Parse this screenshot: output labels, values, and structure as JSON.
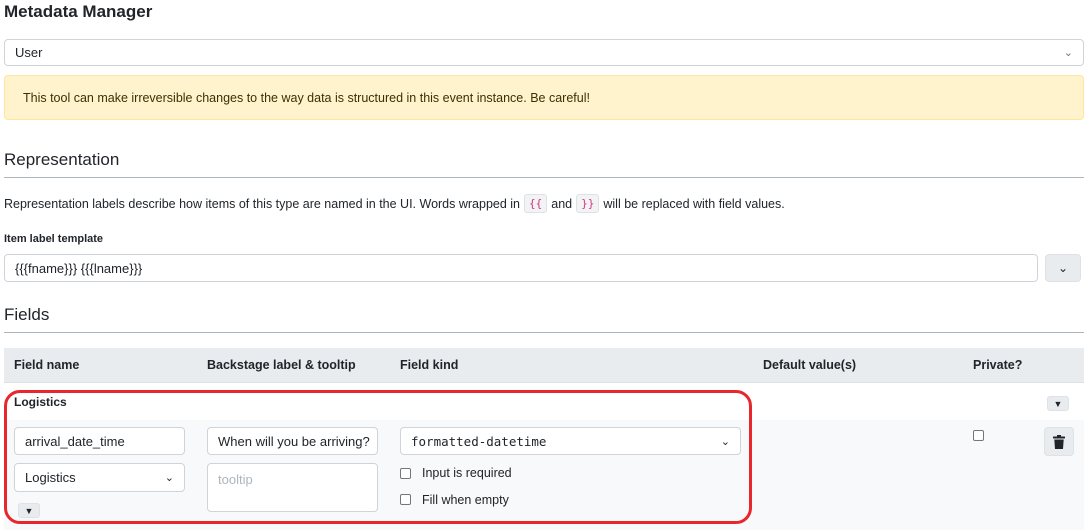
{
  "page_title": "Metadata Manager",
  "type_select": {
    "value": "User"
  },
  "warning": "This tool can make irreversible changes to the way data is structured in this event instance. Be careful!",
  "representation": {
    "heading": "Representation",
    "desc_before": "Representation labels describe how items of this type are named in the UI. Words wrapped in",
    "open_brace": "{{",
    "desc_and": "and",
    "close_brace": "}}",
    "desc_after": "will be replaced with field values.",
    "template_label": "Item label template",
    "template_value": "{{{fname}}} {{{lname}}}"
  },
  "fields": {
    "heading": "Fields",
    "columns": [
      "Field name",
      "Backstage label & tooltip",
      "Field kind",
      "Default value(s)",
      "Private?"
    ],
    "group": {
      "name": "Logistics"
    },
    "row": {
      "field_name": "arrival_date_time",
      "backstage_label": "When will you be arriving?",
      "tooltip_placeholder": "tooltip",
      "group_select": "Logistics",
      "field_kind": "formatted-datetime",
      "input_required_label": "Input is required",
      "fill_when_empty_label": "Fill when empty",
      "private": false
    }
  },
  "icons": {
    "chevron": "chevron-down-icon",
    "collapse": "triangle-down-icon",
    "trash": "trash-icon"
  },
  "colors": {
    "warning_bg": "#fff3cd",
    "highlight": "#e8262c",
    "header_bg": "#e9ecef"
  }
}
